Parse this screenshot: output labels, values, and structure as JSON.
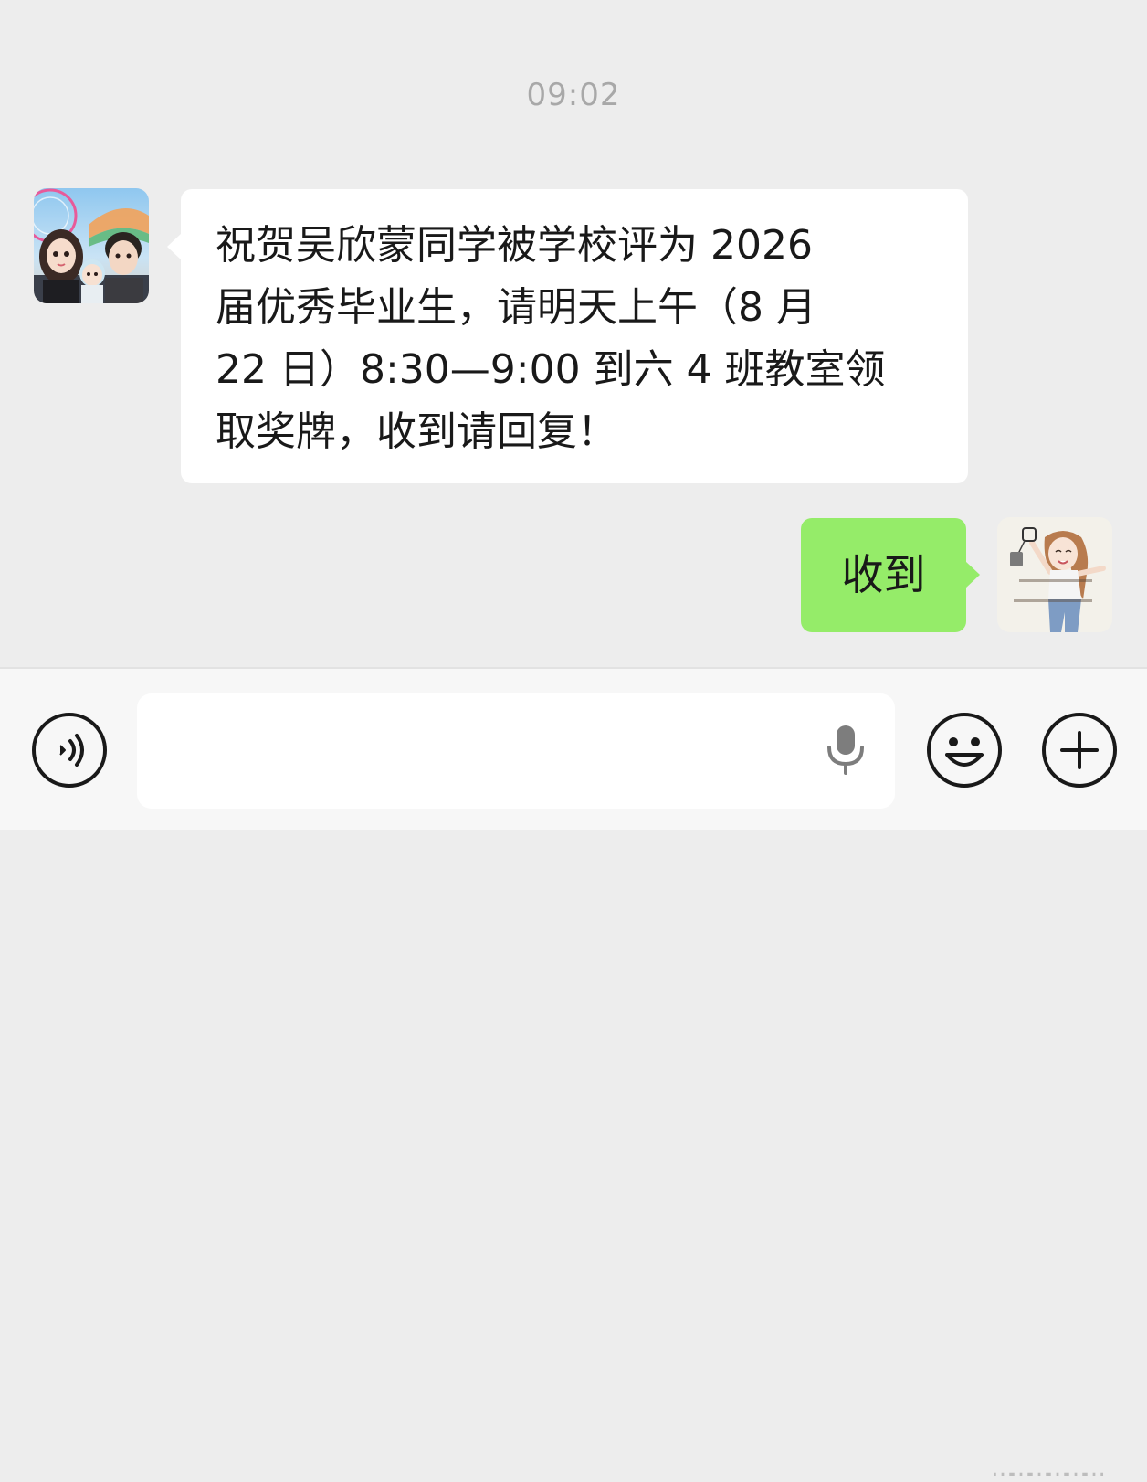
{
  "chat": {
    "timestamp": "09:02",
    "incoming": {
      "lines": [
        "祝贺吴欣蒙同学被学校评为 2026",
        "届优秀毕业生，请明天上午（8 月",
        "22 日）8:30—9:00 到六 4 班教室领",
        "取奖牌，收到请回复！"
      ]
    },
    "outgoing": {
      "text": "收到"
    }
  },
  "input_bar": {
    "value": "",
    "placeholder": "",
    "icons": {
      "voice": "voice-mode-icon",
      "mic": "microphone-icon",
      "emoji": "emoji-icon",
      "plus": "plus-icon"
    }
  },
  "watermark": {
    "text": "………………"
  },
  "colors": {
    "background": "#ededed",
    "incoming_bubble": "#ffffff",
    "outgoing_bubble": "#95ec69",
    "timestamp": "#a8a8a8",
    "input_bar": "#f7f7f7"
  }
}
